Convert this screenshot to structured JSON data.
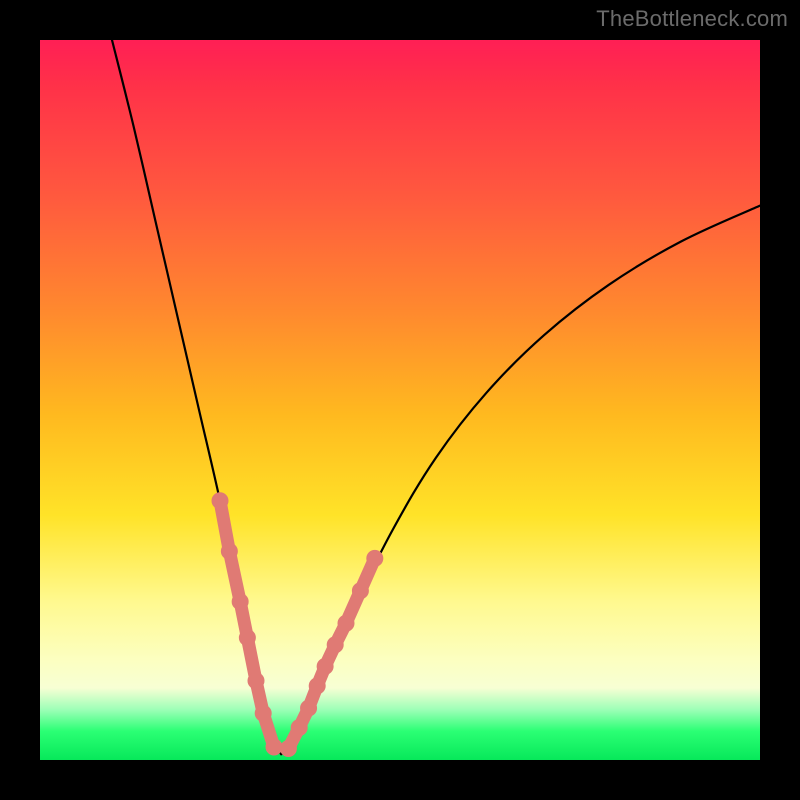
{
  "watermark": "TheBottleneck.com",
  "colors": {
    "background": "#000000",
    "gradient_top": "#ff1f55",
    "gradient_mid": "#ffe328",
    "gradient_bottom": "#07e85a",
    "curve": "#000000",
    "markers": "#e07a74"
  },
  "chart_data": {
    "type": "line",
    "title": "",
    "xlabel": "",
    "ylabel": "",
    "xlim": [
      0,
      100
    ],
    "ylim": [
      0,
      100
    ],
    "grid": false,
    "legend": null,
    "description": "V-shaped bottleneck curve over a heat gradient. Minimum (optimal, green) near x≈33; both branches rise steeply toward red at the edges. Salmon markers highlight points near the trough on both branches.",
    "series": [
      {
        "name": "left-branch",
        "x": [
          10,
          13,
          16,
          19,
          22,
          25,
          27,
          29,
          30.5,
          32,
          33.5
        ],
        "values": [
          100,
          88,
          75,
          62,
          49,
          36,
          26,
          16,
          9,
          3.3,
          0.8
        ]
      },
      {
        "name": "right-branch",
        "x": [
          33.5,
          35,
          37,
          40,
          44,
          49,
          55,
          62,
          70,
          79,
          89,
          100
        ],
        "values": [
          0.8,
          2.2,
          6.2,
          13,
          22,
          32,
          42,
          51,
          59,
          66,
          72,
          77
        ]
      }
    ],
    "markers": [
      {
        "branch": "left",
        "x": 25.0,
        "y": 36
      },
      {
        "branch": "left",
        "x": 26.3,
        "y": 29
      },
      {
        "branch": "left",
        "x": 27.8,
        "y": 22
      },
      {
        "branch": "left",
        "x": 28.8,
        "y": 17
      },
      {
        "branch": "left",
        "x": 30.0,
        "y": 11
      },
      {
        "branch": "left",
        "x": 31.0,
        "y": 6.5
      },
      {
        "branch": "left",
        "x": 32.5,
        "y": 1.8
      },
      {
        "branch": "right",
        "x": 34.5,
        "y": 1.6
      },
      {
        "branch": "right",
        "x": 36.0,
        "y": 4.5
      },
      {
        "branch": "right",
        "x": 37.3,
        "y": 7.2
      },
      {
        "branch": "right",
        "x": 38.5,
        "y": 10.3
      },
      {
        "branch": "right",
        "x": 39.6,
        "y": 13
      },
      {
        "branch": "right",
        "x": 41.0,
        "y": 16
      },
      {
        "branch": "right",
        "x": 42.5,
        "y": 19
      },
      {
        "branch": "right",
        "x": 44.5,
        "y": 23.5
      },
      {
        "branch": "right",
        "x": 46.5,
        "y": 28
      }
    ]
  }
}
